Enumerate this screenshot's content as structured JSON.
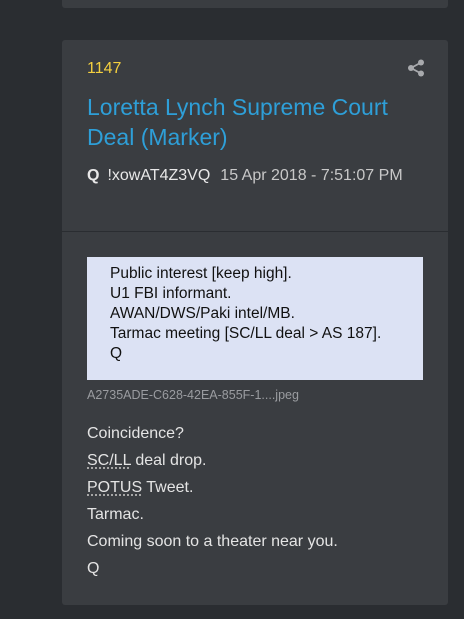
{
  "post": {
    "number": "1147",
    "title": "Loretta Lynch Supreme Court Deal (Marker)",
    "author_name": "Q",
    "tripcode": "!xowAT4Z3VQ",
    "timestamp": "15 Apr 2018 - 7:51:07 PM",
    "attachment": {
      "image_text": "Public interest [keep high].\nU1 FBI informant.\nAWAN/DWS/Paki intel/MB.\nTarmac meeting [SC/LL deal > AS 187].\nQ",
      "filename": "A2735ADE-C628-42EA-855F-1....jpeg"
    },
    "body": {
      "line1": "Coincidence?",
      "line2_abbr": "SC/LL",
      "line2_rest": " deal drop.",
      "line3_abbr": "POTUS",
      "line3_rest": " Tweet.",
      "line4": "Tarmac.",
      "line5": "Coming soon to a theater near you.",
      "line6": "Q"
    }
  },
  "colors": {
    "background": "#2a2d31",
    "card": "#3a3d41",
    "post_number": "#f4d03f",
    "title": "#2e9fd8"
  },
  "icons": {
    "share": "share-icon"
  }
}
